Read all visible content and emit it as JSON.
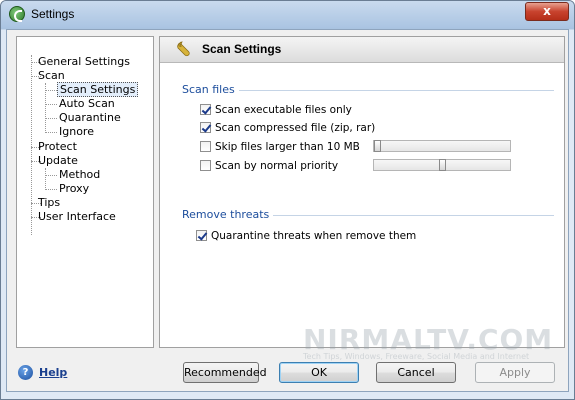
{
  "window": {
    "title": "Settings",
    "close_label": "x"
  },
  "tree": {
    "items": [
      {
        "label": "General Settings"
      },
      {
        "label": "Scan"
      },
      {
        "label": "Scan Settings"
      },
      {
        "label": "Auto Scan"
      },
      {
        "label": "Quarantine"
      },
      {
        "label": "Ignore"
      },
      {
        "label": "Protect"
      },
      {
        "label": "Update"
      },
      {
        "label": "Method"
      },
      {
        "label": "Proxy"
      },
      {
        "label": "Tips"
      },
      {
        "label": "User Interface"
      }
    ],
    "expander": {
      "scan": "−",
      "update": "−"
    }
  },
  "panel": {
    "title": "Scan Settings",
    "icon": "wrench-icon",
    "groups": {
      "scan_files": {
        "label": "Scan files",
        "options": [
          {
            "label": "Scan executable files only",
            "checked": true
          },
          {
            "label": "Scan compressed file (zip, rar)",
            "checked": true
          },
          {
            "label": "Skip files larger than 10 MB",
            "checked": false,
            "slider_level": 0
          },
          {
            "label": "Scan by normal priority",
            "checked": false,
            "slider_level": 0.5
          }
        ]
      },
      "remove_threats": {
        "label": "Remove threats",
        "options": [
          {
            "label": "Quarantine threats when remove them",
            "checked": true
          }
        ]
      }
    }
  },
  "footer": {
    "help_label": "Help",
    "buttons": {
      "recommended": "Recommended",
      "ok": "OK",
      "cancel": "Cancel",
      "apply": "Apply"
    }
  },
  "watermark": {
    "brand": "NIRMALTV.COM",
    "tagline": "Tech Tips, Windows, Freeware, Social Media and Internet"
  }
}
